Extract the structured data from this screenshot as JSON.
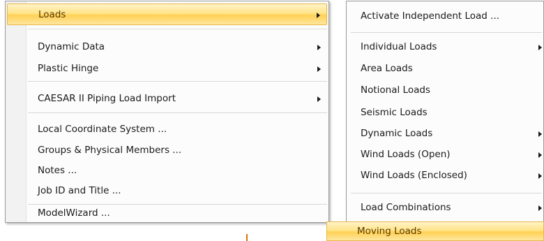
{
  "left_menu": {
    "items": [
      {
        "label": "Loads",
        "submenu": true,
        "highlighted": true
      },
      {
        "label": "Dynamic Data",
        "submenu": true
      },
      {
        "label": "Plastic Hinge",
        "submenu": true
      },
      {
        "label": "CAESAR II Piping Load Import",
        "submenu": true
      },
      {
        "label": "Local Coordinate System ...",
        "submenu": false
      },
      {
        "label": "Groups & Physical Members ...",
        "submenu": false
      },
      {
        "label": "Notes ...",
        "submenu": false
      },
      {
        "label": "Job ID and Title ...",
        "submenu": false
      },
      {
        "label": "ModelWizard ...",
        "submenu": false
      }
    ]
  },
  "right_menu": {
    "items": [
      {
        "label": "Activate Independent Load ...",
        "submenu": false
      },
      {
        "label": "Individual Loads",
        "submenu": true
      },
      {
        "label": "Area Loads",
        "submenu": false
      },
      {
        "label": "Notional Loads",
        "submenu": false
      },
      {
        "label": "Seismic Loads",
        "submenu": false
      },
      {
        "label": "Dynamic Loads",
        "submenu": true
      },
      {
        "label": "Wind Loads (Open)",
        "submenu": true
      },
      {
        "label": "Wind Loads (Enclosed)",
        "submenu": true
      },
      {
        "label": "Load Combinations",
        "submenu": true
      },
      {
        "label": "Moving Loads",
        "submenu": false,
        "highlighted": true
      }
    ]
  },
  "colors": {
    "highlight": "#ffd154",
    "highlight_border": "#e6b84a",
    "menu_bg": "#fcfcfc"
  }
}
